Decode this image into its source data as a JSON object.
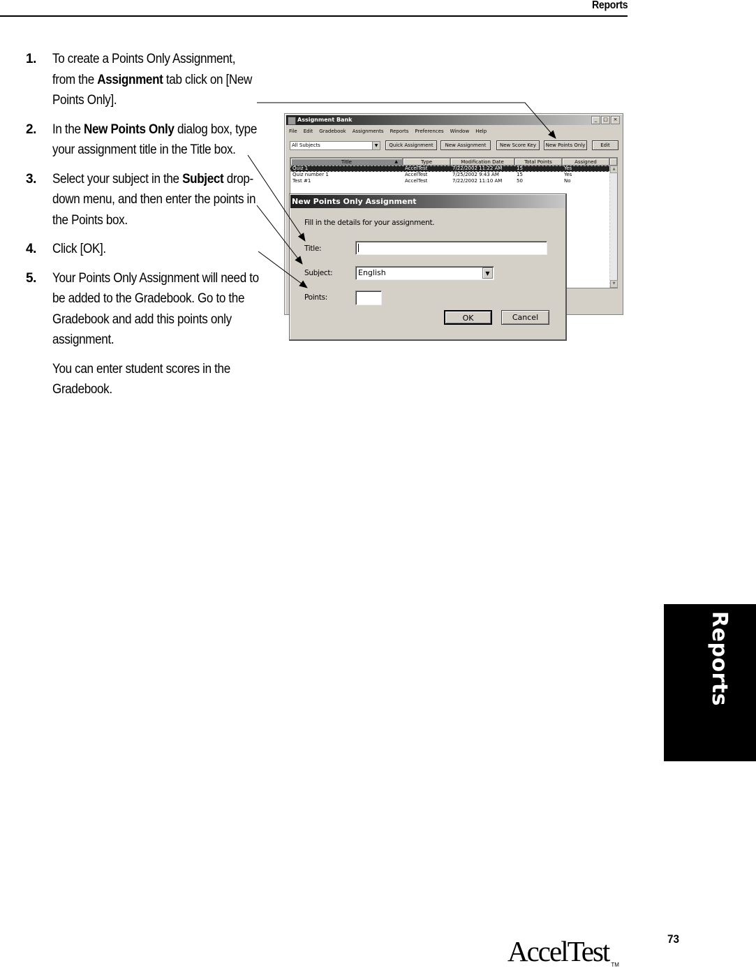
{
  "header": {
    "section": "Reports"
  },
  "steps": [
    {
      "num": "1.",
      "parts": [
        "To create a Points Only Assignment, from the ",
        "Assignment",
        " tab click on [New Points Only]."
      ]
    },
    {
      "num": "2.",
      "parts": [
        "In the ",
        "New Points Only",
        " dialog box, type your assignment title in the Title box."
      ]
    },
    {
      "num": "3.",
      "parts": [
        "Select your subject in the ",
        "Subject",
        " drop-down menu, and then enter the points in the Points box."
      ]
    },
    {
      "num": "4.",
      "parts": [
        "Click [OK]."
      ]
    },
    {
      "num": "5.",
      "parts": [
        "Your Points Only Assignment will need to be added to the Gradebook. Go to the Gradebook and add this points only assignment."
      ]
    }
  ],
  "note": "You can enter student scores in the Gradebook.",
  "assignment_bank": {
    "title": "Assignment Bank",
    "window_buttons": [
      "_",
      "□",
      "×"
    ],
    "menu": [
      "File",
      "Edit",
      "Gradebook",
      "Assignments",
      "Reports",
      "Preferences",
      "Window",
      "Help"
    ],
    "subject_filter": "All Subjects",
    "toolbar": {
      "quick_assignment": "Quick Assignment",
      "new_assignment": "New Assignment",
      "new_score_key": "New Score Key",
      "new_points_only": "New Points Only",
      "edit": "Edit"
    },
    "columns": [
      "Title",
      "Type",
      "Modification Date",
      "Total Points",
      "Assigned"
    ],
    "sort_indicator": "▲",
    "rows": [
      {
        "title": "Quiz 1",
        "type": "AccelTest",
        "date": "7/22/2002 11:22 AM",
        "points": "15",
        "assigned": "Yes",
        "selected": true
      },
      {
        "title": "Quiz number 1",
        "type": "AccelTest",
        "date": "7/25/2002 9:43 AM",
        "points": "15",
        "assigned": "Yes",
        "selected": false
      },
      {
        "title": "Test #1",
        "type": "AccelTest",
        "date": "7/22/2002 11:10 AM",
        "points": "50",
        "assigned": "No",
        "selected": false
      }
    ]
  },
  "dialog": {
    "title": "New Points Only Assignment",
    "intro": "Fill in the details for your assignment.",
    "title_label": "Title:",
    "title_value": "",
    "subject_label": "Subject:",
    "subject_value": "English",
    "points_label": "Points:",
    "points_value": "",
    "ok": "OK",
    "cancel": "Cancel"
  },
  "thumb_tab": "Reports",
  "footer": {
    "page_number": "73",
    "brand": "AccelTest",
    "trademark": "TM"
  }
}
